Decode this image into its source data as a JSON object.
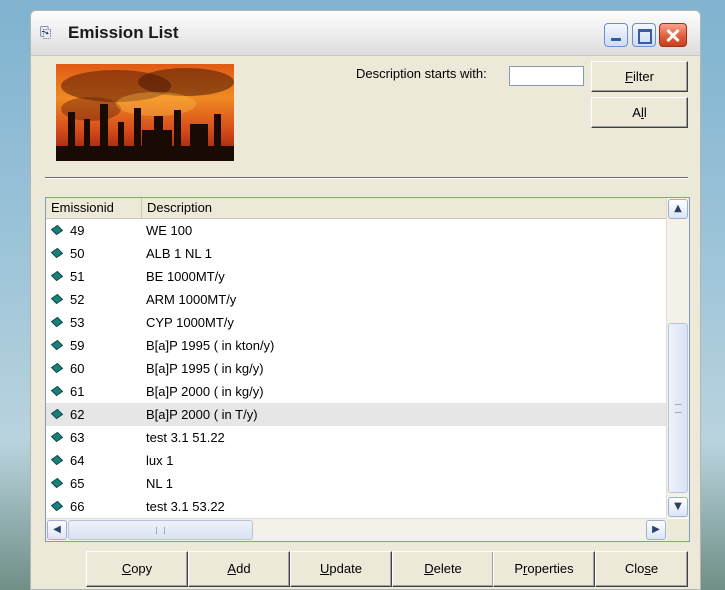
{
  "window": {
    "title": "Emission List",
    "icon": "app-icon"
  },
  "filter": {
    "label": "Description starts with:",
    "value": "",
    "filter_button": {
      "prefix": "",
      "key": "F",
      "suffix": "ilter"
    },
    "all_button": {
      "prefix": "A",
      "key": "l",
      "suffix": "l"
    }
  },
  "list": {
    "columns": [
      "Emissionid",
      "Description"
    ],
    "rows": [
      {
        "id": "49",
        "description": "WE 100"
      },
      {
        "id": "50",
        "description": "ALB 1 NL 1"
      },
      {
        "id": "51",
        "description": "BE 1000MT/y"
      },
      {
        "id": "52",
        "description": "ARM 1000MT/y"
      },
      {
        "id": "53",
        "description": "CYP 1000MT/y"
      },
      {
        "id": "59",
        "description": "B[a]P 1995 ( in kton/y)"
      },
      {
        "id": "60",
        "description": "B[a]P 1995 ( in kg/y)"
      },
      {
        "id": "61",
        "description": "B[a]P 2000 ( in kg/y)"
      },
      {
        "id": "62",
        "description": "B[a]P 2000 ( in T/y)",
        "selected": true
      },
      {
        "id": "63",
        "description": "test 3.1 51.22"
      },
      {
        "id": "64",
        "description": "lux 1"
      },
      {
        "id": "65",
        "description": "NL 1"
      },
      {
        "id": "66",
        "description": "test 3.1 53.22"
      }
    ]
  },
  "buttons": [
    {
      "name": "copy-button",
      "prefix": "",
      "key": "C",
      "suffix": "opy"
    },
    {
      "name": "add-button",
      "prefix": "",
      "key": "A",
      "suffix": "dd"
    },
    {
      "name": "update-button",
      "prefix": "",
      "key": "U",
      "suffix": "pdate"
    },
    {
      "name": "delete-button",
      "prefix": "",
      "key": "D",
      "suffix": "elete"
    },
    {
      "name": "properties-button",
      "prefix": "P",
      "key": "r",
      "suffix": "operties"
    },
    {
      "name": "close-button",
      "prefix": "Clo",
      "key": "s",
      "suffix": "e"
    }
  ],
  "colors": {
    "selected_row": "#e6e6e6",
    "window_bg": "#ece9d8",
    "row_icon": "#1d7f7a"
  }
}
